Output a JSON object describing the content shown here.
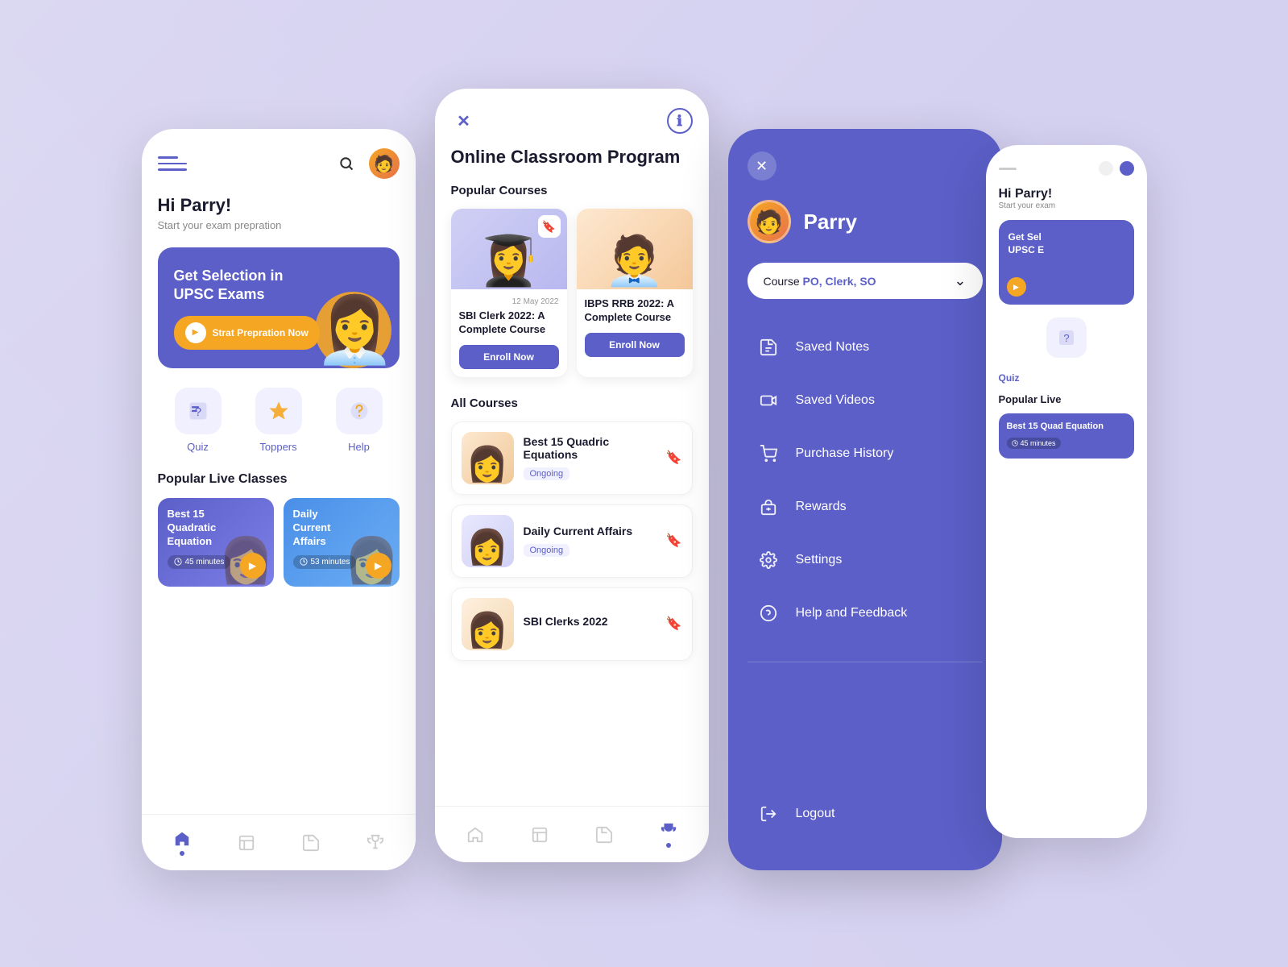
{
  "bg_color": "#d4d0f0",
  "accent_color": "#5b5fc7",
  "orange_color": "#f5a623",
  "phone1": {
    "greeting": "Hi Parry!",
    "greeting_sub": "Start your exam prepration",
    "banner": {
      "title": "Get Selection in UPSC Exams",
      "cta": "Strat Prepration Now"
    },
    "quick_links": [
      {
        "label": "Quiz",
        "emoji": "📋"
      },
      {
        "label": "Toppers",
        "emoji": "⭐"
      },
      {
        "label": "Help",
        "emoji": "🎧"
      }
    ],
    "popular_section_title": "Popular Live Classes",
    "live_classes": [
      {
        "title": "Best 15 Quadratic Equation",
        "duration": "45 minutes",
        "color": "purple"
      },
      {
        "title": "Daily Current Affairs",
        "duration": "53 minutes",
        "color": "blue"
      }
    ]
  },
  "phone2": {
    "page_title": "Online Classroom Program",
    "popular_section_title": "Popular Courses",
    "all_section_title": "All Courses",
    "popular_courses": [
      {
        "title": "SBI Clerk 2022: A Complete Course",
        "date": "12 May 2022",
        "bg": "purple-bg",
        "enroll_label": "Enroll Now"
      },
      {
        "title": "IBPS RRB 2022: A Complete Course",
        "date": "",
        "bg": "orange-bg",
        "enroll_label": "Enroll Now"
      }
    ],
    "all_courses": [
      {
        "title": "Best 15 Quadric Equations",
        "status": "Ongoing",
        "bg": "peach"
      },
      {
        "title": "Daily Current Affairs",
        "status": "Ongoing",
        "bg": "light-purple"
      },
      {
        "title": "SBI Clerks 2022",
        "status": "",
        "bg": "light-orange"
      }
    ],
    "bottom_nav": [
      {
        "icon": "🏠",
        "active": false
      },
      {
        "icon": "📚",
        "active": false
      },
      {
        "icon": "📝",
        "active": false
      },
      {
        "icon": "🏆",
        "active": true
      }
    ]
  },
  "phone3": {
    "user_name": "Parry",
    "course_dropdown": {
      "prefix": "Course",
      "value": "PO, Clerk, SO"
    },
    "menu_items": [
      {
        "label": "Saved Notes",
        "icon": "📋"
      },
      {
        "label": "Saved Videos",
        "icon": "🎬"
      },
      {
        "label": "Purchase History",
        "icon": "🛒"
      },
      {
        "label": "Rewards",
        "icon": "🎁"
      },
      {
        "label": "Settings",
        "icon": "⚙️"
      },
      {
        "label": "Help and Feedback",
        "icon": "💬"
      }
    ],
    "logout_label": "Logout"
  },
  "phone4": {
    "greeting": "Hi Parry!",
    "greeting_sub": "Start your exam",
    "banner_text": "Get Sel UPSC E",
    "live_class_title": "Best 15 Quad Equation",
    "live_duration": "45 minutes"
  }
}
